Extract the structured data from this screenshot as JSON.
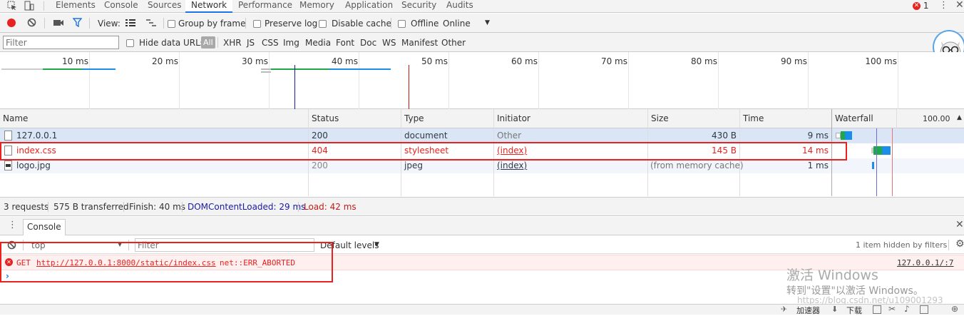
{
  "tabs": [
    "Elements",
    "Console",
    "Sources",
    "Network",
    "Performance",
    "Memory",
    "Application",
    "Security",
    "Audits"
  ],
  "active_tab": "Network",
  "error_count": "1",
  "toolbar": {
    "view_label": "View:",
    "group_by_frame": "Group by frame",
    "preserve_log": "Preserve log",
    "disable_cache": "Disable cache",
    "offline": "Offline",
    "throttle": "Online"
  },
  "filterbar": {
    "filter_placeholder": "Filter",
    "hide_data_urls": "Hide data URLs",
    "types": [
      "All",
      "XHR",
      "JS",
      "CSS",
      "Img",
      "Media",
      "Font",
      "Doc",
      "WS",
      "Manifest",
      "Other"
    ]
  },
  "overview": {
    "ticks": [
      "10 ms",
      "20 ms",
      "30 ms",
      "40 ms",
      "50 ms",
      "60 ms",
      "70 ms",
      "80 ms",
      "90 ms",
      "100 ms"
    ]
  },
  "table": {
    "headers": {
      "name": "Name",
      "status": "Status",
      "type": "Type",
      "initiator": "Initiator",
      "size": "Size",
      "time": "Time",
      "waterfall": "Waterfall",
      "waterfall_scale": "100.00"
    },
    "rows": [
      {
        "name": "127.0.0.1",
        "status": "200",
        "type": "document",
        "initiator": "Other",
        "size": "430 B",
        "time": "9 ms"
      },
      {
        "name": "index.css",
        "status": "404",
        "type": "stylesheet",
        "initiator": "(index)",
        "size": "145 B",
        "time": "14 ms"
      },
      {
        "name": "logo.jpg",
        "status": "200",
        "type": "jpeg",
        "initiator": "(index)",
        "size": "(from memory cache)",
        "time": "1 ms"
      }
    ]
  },
  "statusbar": {
    "requests": "3 requests",
    "transferred": "575 B transferred",
    "finish": "Finish: 40 ms",
    "dcl": "DOMContentLoaded: 29 ms",
    "load": "Load: 42 ms"
  },
  "drawer": {
    "tab": "Console",
    "context": "top",
    "filter_placeholder": "Filter",
    "levels": "Default levels",
    "hidden": "1 item hidden by filters"
  },
  "console_error": {
    "method": "GET",
    "url": "http://127.0.0.1:8000/static/index.css",
    "error": "net::ERR_ABORTED",
    "source": "127.0.0.1/:7"
  },
  "watermark": {
    "line1": "激活 Windows",
    "line2": "转到\"设置\"以激活 Windows。",
    "url": "https://blog.csdn.net/u109001293"
  },
  "bottom": {
    "speed": "加速器",
    "download": "下载"
  },
  "colors": {
    "accent": "#1a73e8",
    "error": "#e8221f",
    "dcl": "#1a1aa6",
    "load": "#c41a16"
  }
}
